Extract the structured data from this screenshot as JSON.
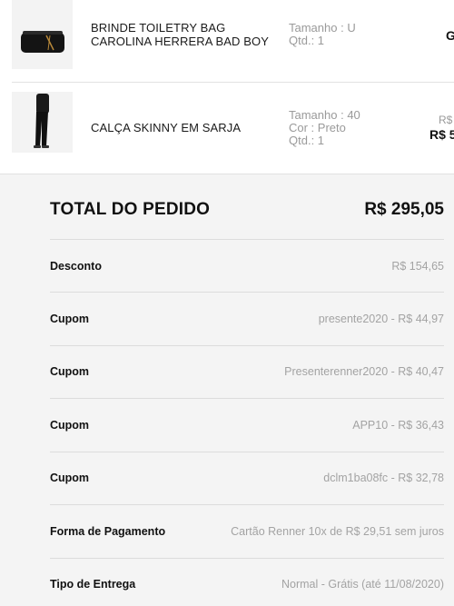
{
  "items": [
    {
      "name": "BRINDE TOILETRY BAG CAROLINA HERRERA BAD BOY",
      "attrs": [
        "Tamanho : U",
        "Qtd.: 1"
      ],
      "price_visible": "G"
    },
    {
      "name": "CALÇA SKINNY EM SARJA",
      "attrs": [
        "Tamanho : 40",
        "Cor : Preto",
        "Qtd.: 1"
      ],
      "old_price_visible": "R$",
      "price_visible": "R$ 5"
    }
  ],
  "summary": {
    "total_label": "TOTAL DO PEDIDO",
    "total_value": "R$ 295,05",
    "rows": [
      {
        "label": "Desconto",
        "value": "R$ 154,65"
      },
      {
        "label": "Cupom",
        "code": "presente2020",
        "sep": " - ",
        "value": "R$ 44,97"
      },
      {
        "label": "Cupom",
        "code": "Presenterenner2020",
        "sep": " - ",
        "value": "R$ 40,47"
      },
      {
        "label": "Cupom",
        "code": "APP10",
        "sep": " - ",
        "value": "R$ 36,43"
      },
      {
        "label": "Cupom",
        "code": "dclm1ba08fc",
        "sep": " - ",
        "value": "R$ 32,78"
      },
      {
        "label": "Forma de Pagamento",
        "value": "Cartão Renner 10x de R$ 29,51 sem juros"
      },
      {
        "label": "Tipo de Entrega",
        "value": "Normal - Grátis (até 11/08/2020)"
      }
    ]
  }
}
